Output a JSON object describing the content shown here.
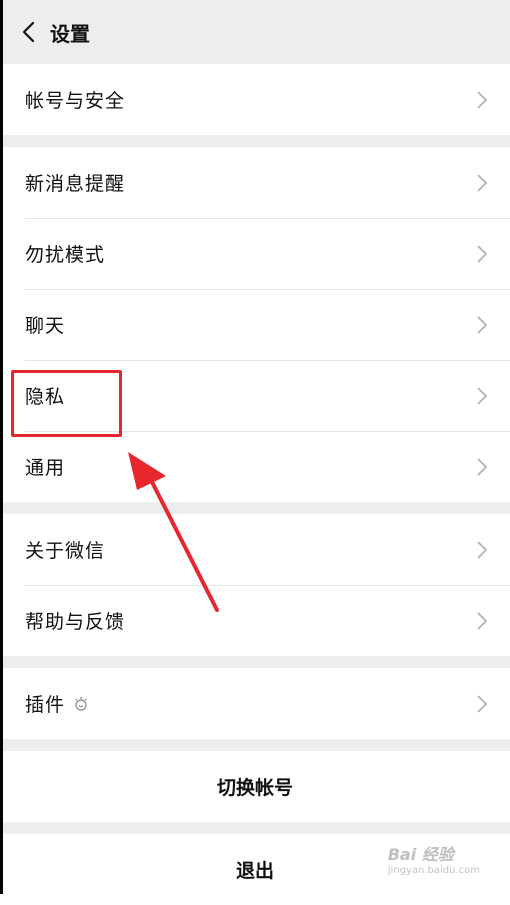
{
  "header": {
    "title": "设置"
  },
  "groups": {
    "account": {
      "label": "帐号与安全"
    },
    "general": [
      {
        "label": "新消息提醒"
      },
      {
        "label": "勿扰模式"
      },
      {
        "label": "聊天"
      },
      {
        "label": "隐私"
      },
      {
        "label": "通用"
      }
    ],
    "about": [
      {
        "label": "关于微信"
      },
      {
        "label": "帮助与反馈"
      }
    ],
    "plugins": {
      "label": "插件"
    }
  },
  "actions": {
    "switch_account": "切换帐号",
    "logout": "退出"
  },
  "watermark": {
    "brand": "Bai 经验",
    "url": "jingyan.baidu.com"
  },
  "colors": {
    "highlight": "#e8262d",
    "background": "#ededed",
    "card": "#ffffff"
  }
}
